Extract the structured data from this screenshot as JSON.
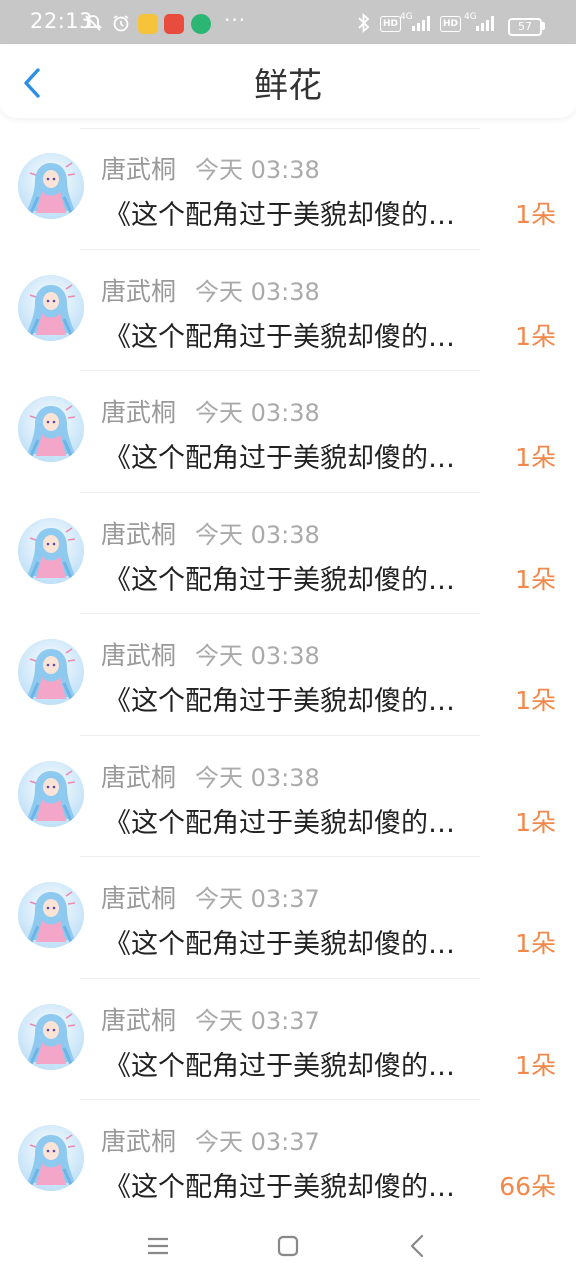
{
  "status_bar": {
    "time": "22:13",
    "dots": "···",
    "net_labels": [
      "HD",
      "4G",
      "HD",
      "4G"
    ],
    "battery": "57"
  },
  "header": {
    "title": "鲜花"
  },
  "items": [
    {
      "name": "唐武桐",
      "time": "今天 03:38",
      "title": "《这个配角过于美貌却傻的…",
      "amount": "1朵"
    },
    {
      "name": "唐武桐",
      "time": "今天 03:38",
      "title": "《这个配角过于美貌却傻的…",
      "amount": "1朵"
    },
    {
      "name": "唐武桐",
      "time": "今天 03:38",
      "title": "《这个配角过于美貌却傻的…",
      "amount": "1朵"
    },
    {
      "name": "唐武桐",
      "time": "今天 03:38",
      "title": "《这个配角过于美貌却傻的…",
      "amount": "1朵"
    },
    {
      "name": "唐武桐",
      "time": "今天 03:38",
      "title": "《这个配角过于美貌却傻的…",
      "amount": "1朵"
    },
    {
      "name": "唐武桐",
      "time": "今天 03:38",
      "title": "《这个配角过于美貌却傻的…",
      "amount": "1朵"
    },
    {
      "name": "唐武桐",
      "time": "今天 03:37",
      "title": "《这个配角过于美貌却傻的…",
      "amount": "1朵"
    },
    {
      "name": "唐武桐",
      "time": "今天 03:37",
      "title": "《这个配角过于美貌却傻的…",
      "amount": "1朵"
    },
    {
      "name": "唐武桐",
      "time": "今天 03:37",
      "title": "《这个配角过于美貌却傻的…",
      "amount": "66朵"
    }
  ],
  "icons": {
    "back": "chevron-left-icon",
    "nav_menu": "menu-icon",
    "nav_home": "home-square-icon",
    "nav_back": "back-triangle-icon"
  },
  "colors": {
    "accent": "#2b8fe8",
    "amount": "#f2884b",
    "status_bar": "#c7c7c7"
  }
}
